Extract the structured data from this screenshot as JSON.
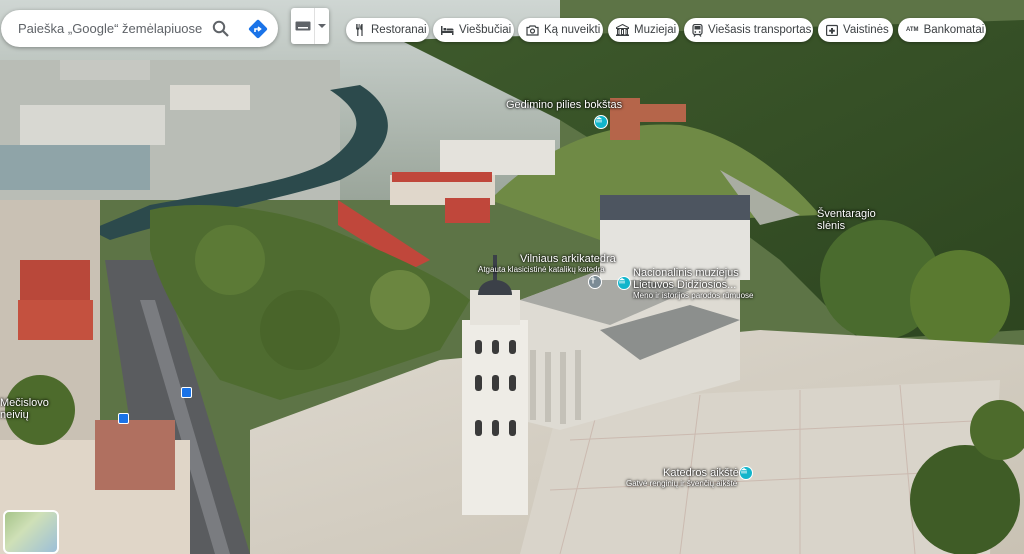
{
  "search": {
    "placeholder": "Paieška „Google“ žemėlapiuose"
  },
  "categories": [
    {
      "label": "Restoranai",
      "icon": "fork-knife-icon"
    },
    {
      "label": "Viešbučiai",
      "icon": "bed-icon"
    },
    {
      "label": "Ką nuveikti",
      "icon": "camera-icon"
    },
    {
      "label": "Muziejai",
      "icon": "museum-icon"
    },
    {
      "label": "Viešasis transportas",
      "icon": "train-icon"
    },
    {
      "label": "Vaistinės",
      "icon": "pharmacy-icon"
    },
    {
      "label": "Bankomatai",
      "icon": "atm-icon"
    }
  ],
  "atm_text": "ATM",
  "places": {
    "gediminas_tower": "Gedimino pilies bokštas",
    "valley": "Šventaragio\nslėnis",
    "cathedral_title": "Vilniaus arkikatedra",
    "cathedral_sub": "Atgauta klasicistinė katalikų katedra",
    "museum_title": "Nacionalinis muziejus\nLietuvos Didžiosios...",
    "museum_sub": "Meno ir istorijos parodos rūmuose",
    "square_title": "Katedros aikštė",
    "square_sub": "Gatvė renginių ir švenčių aikštė",
    "street_left": "Mečislovo\nneivių"
  },
  "colors": {
    "accent_blue": "#1a73e8",
    "poi_teal": "#12b5cb"
  }
}
